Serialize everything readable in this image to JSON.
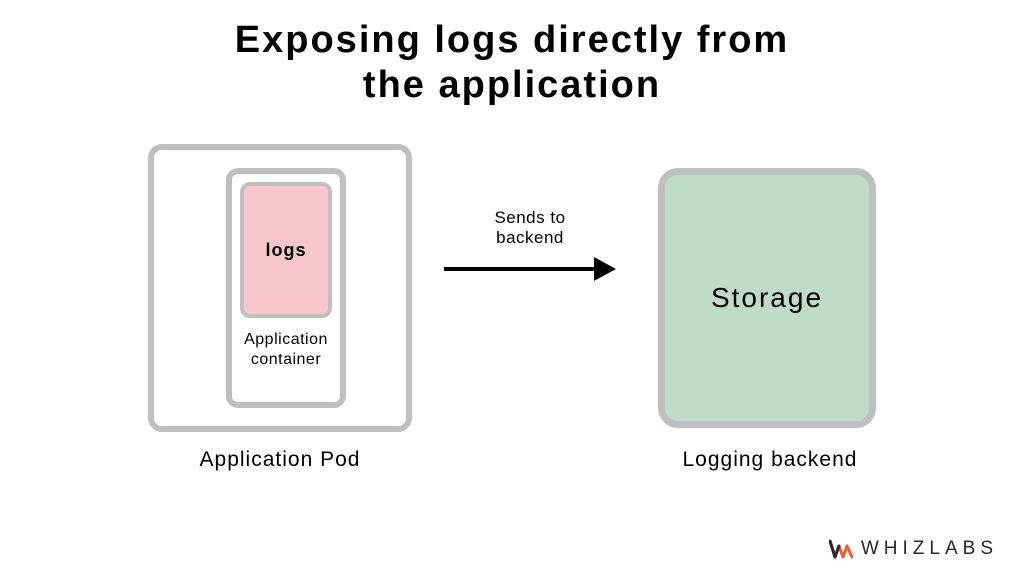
{
  "title_line1": "Exposing logs directly from",
  "title_line2": "the application",
  "pod": {
    "label": "Application Pod",
    "container": {
      "label": "Application\ncontainer",
      "logs_label": "logs"
    }
  },
  "arrow": {
    "label": "Sends to\nbackend"
  },
  "backend": {
    "storage_label": "Storage",
    "label": "Logging backend"
  },
  "brand": {
    "name": "WHIZLABS"
  },
  "colors": {
    "border_gray": "#bfbfbf",
    "logs_fill": "#f7c7cb",
    "storage_fill": "#bedcc9",
    "brand_orange": "#f15a2b",
    "brand_dark": "#2b2b2b"
  }
}
